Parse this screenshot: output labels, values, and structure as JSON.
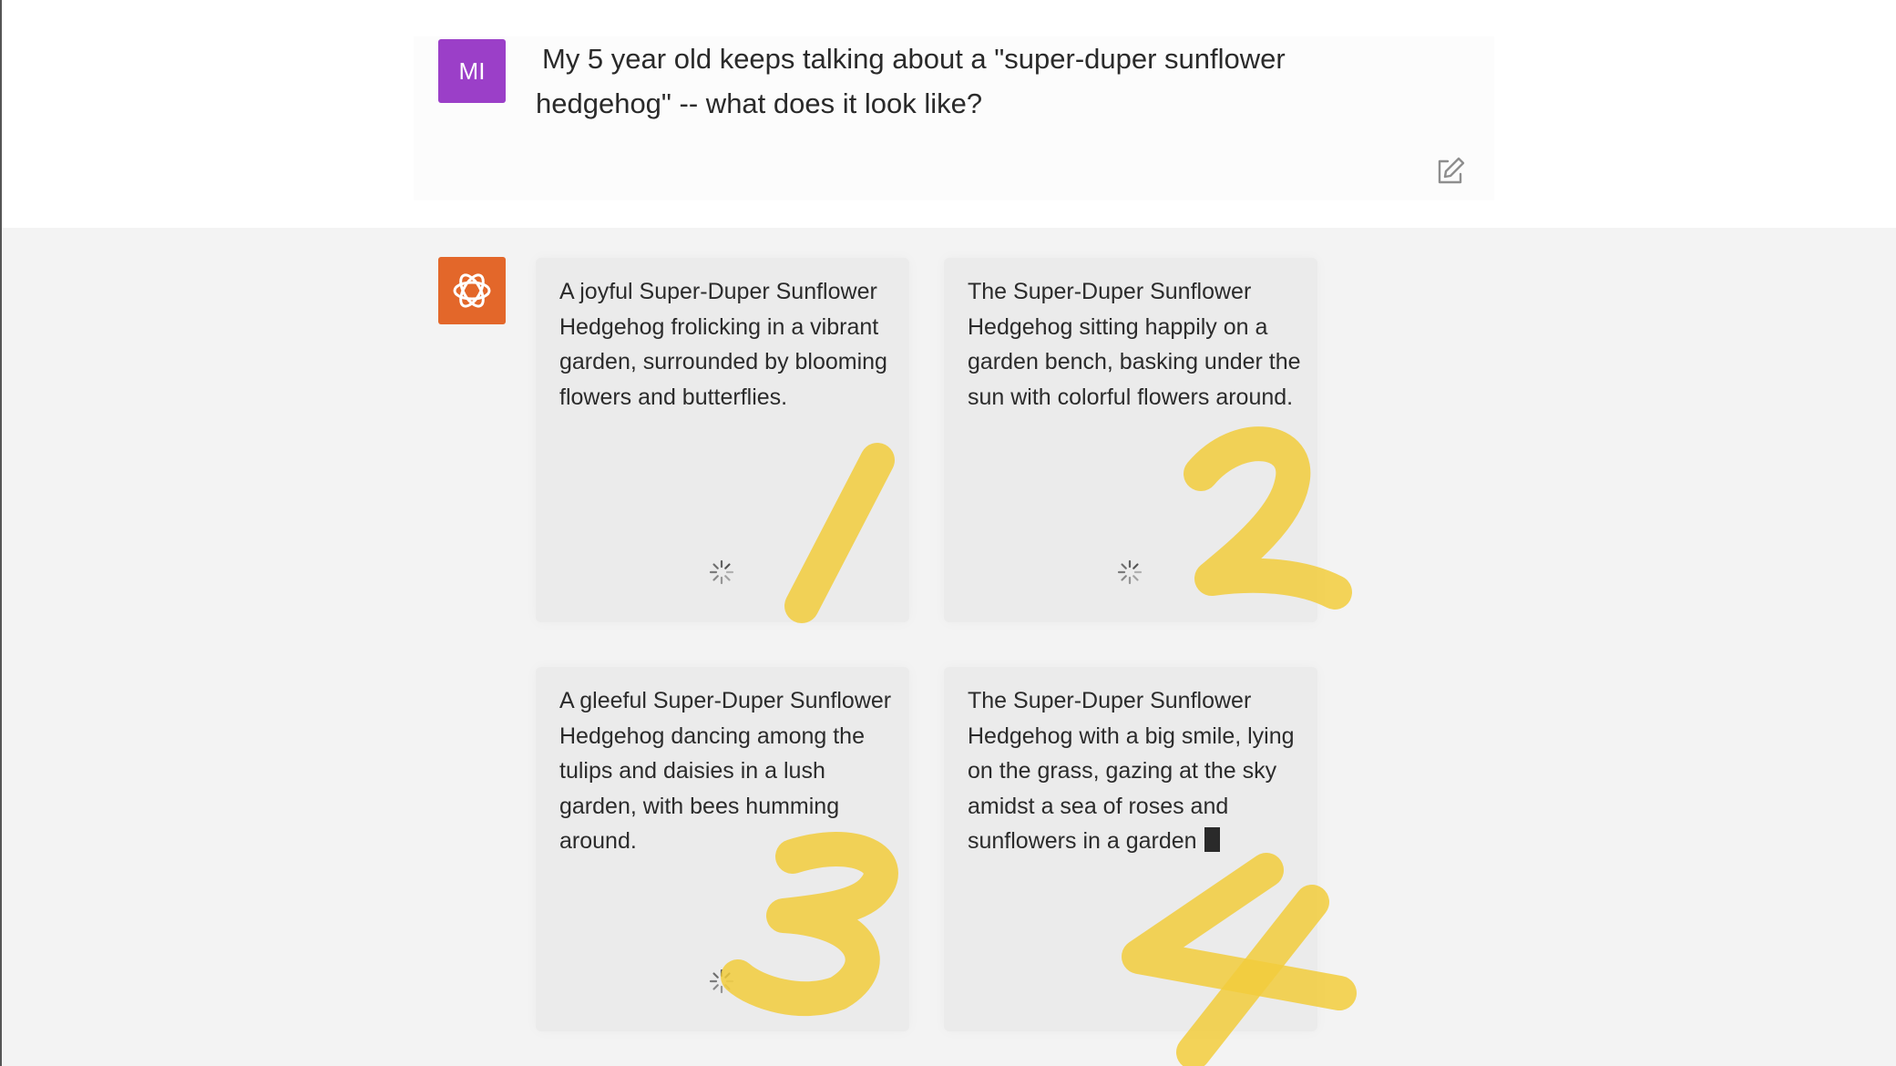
{
  "user": {
    "avatar_initials": "MI",
    "message": "My 5 year old keeps talking about a \"super-duper sunflower hedgehog\" -- what does it look like?"
  },
  "assistant": {
    "cards": [
      {
        "text": "A joyful Super-Duper Sunflower Hedgehog frolicking in a vibrant garden, surrounded by blooming flowers and butterflies."
      },
      {
        "text": "The Super-Duper Sunflower Hedgehog sitting happily on a garden bench, basking under the sun with colorful flowers around."
      },
      {
        "text": "A gleeful Super-Duper Sunflower Hedgehog dancing among the tulips and daisies in a lush garden, with bees humming around."
      },
      {
        "text": "The Super-Duper Sunflower Hedgehog with a big smile, lying on the grass, gazing at the sky amidst a sea of roses and sunflowers in a garden"
      }
    ]
  },
  "annotations": [
    "1",
    "2",
    "3",
    "4"
  ],
  "colors": {
    "user_avatar": "#9b3fc8",
    "bot_avatar": "#e3672a",
    "highlighter": "#f2cc3c"
  },
  "icons": {
    "edit": "pencil-square-icon",
    "bot": "openai-logo-icon",
    "loading": "loading-spinner-icon"
  }
}
